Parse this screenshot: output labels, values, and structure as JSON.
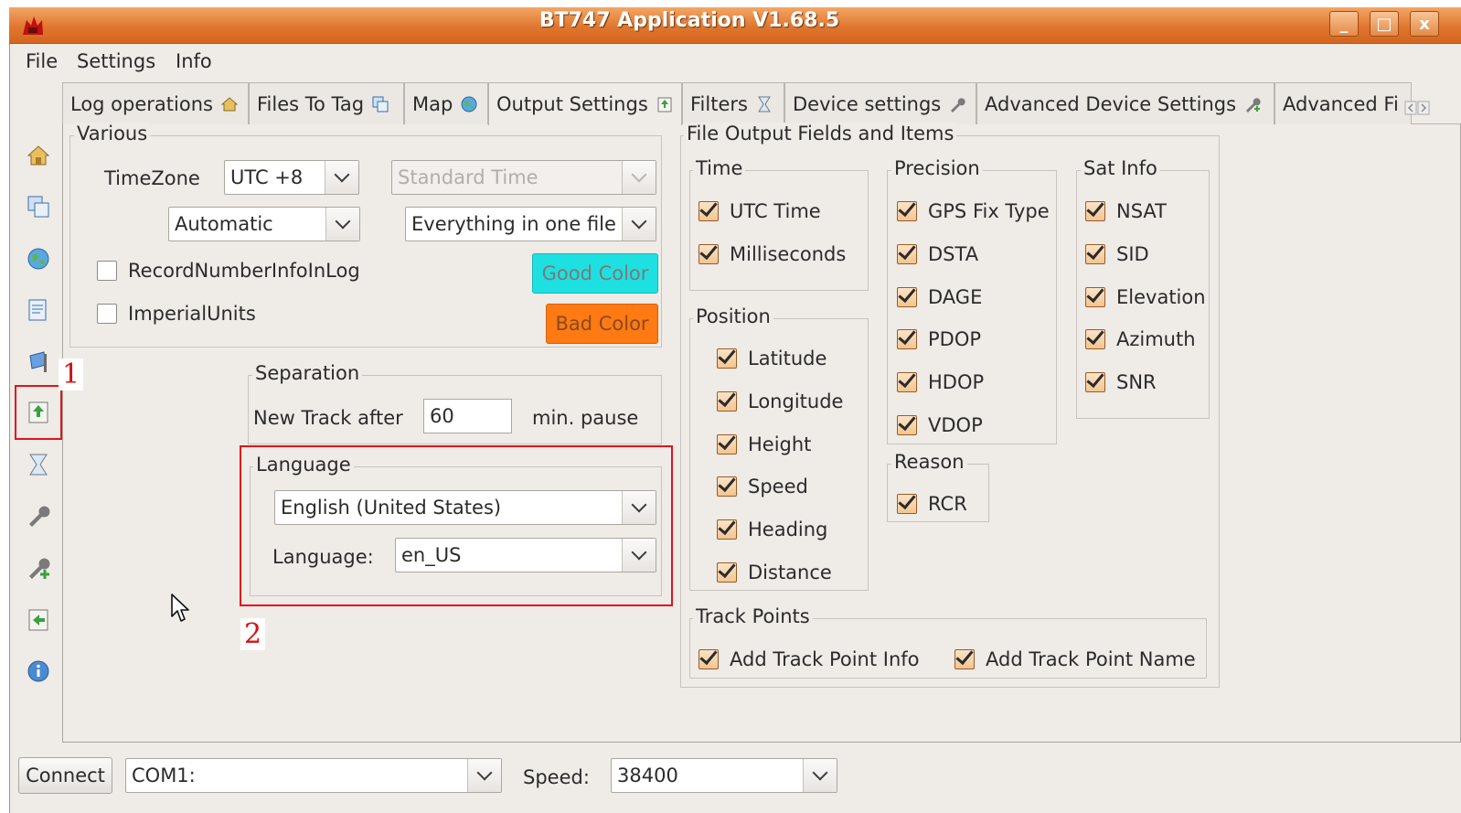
{
  "window": {
    "title": "BT747 Application V1.68.5",
    "controls": {
      "minimize": "_",
      "maximize": "□",
      "close": "x"
    }
  },
  "menu": {
    "items": [
      "File",
      "Settings",
      "Info"
    ]
  },
  "tabs": [
    {
      "label": "Log operations",
      "icon": "home-icon"
    },
    {
      "label": "Files To Tag",
      "icon": "files-icon"
    },
    {
      "label": "Map",
      "icon": "globe-icon"
    },
    {
      "label": "Output Settings",
      "icon": "export-icon",
      "active": true
    },
    {
      "label": "Filters",
      "icon": "hourglass-icon"
    },
    {
      "label": "Device settings",
      "icon": "wrench-icon"
    },
    {
      "label": "Advanced Device Settings",
      "icon": "wrench-plus-icon"
    },
    {
      "label": "Advanced Fi",
      "icon": "scroll-arrows-icon"
    }
  ],
  "various": {
    "legend": "Various",
    "timezone_label": "TimeZone",
    "timezone_value": "UTC +8",
    "standard_time_value": "Standard Time",
    "mode_value": "Automatic",
    "file_split_value": "Everything in one file",
    "record_number_label": "RecordNumberInfoInLog",
    "imperial_units_label": "ImperialUnits",
    "good_color_label": "Good Color",
    "bad_color_label": "Bad Color"
  },
  "separation": {
    "legend": "Separation",
    "new_track_label": "New Track after",
    "new_track_value": "60",
    "unit_label": "min. pause"
  },
  "language": {
    "legend": "Language",
    "language_select_value": "English (United States)",
    "locale_label": "Language:",
    "locale_value": "en_US"
  },
  "file_output": {
    "legend": "File Output Fields and Items",
    "time": {
      "legend": "Time",
      "items": [
        "UTC Time",
        "Milliseconds"
      ]
    },
    "position": {
      "legend": "Position",
      "items": [
        "Latitude",
        "Longitude",
        "Height",
        "Speed",
        "Heading",
        "Distance"
      ]
    },
    "precision": {
      "legend": "Precision",
      "items": [
        "GPS Fix Type",
        "DSTA",
        "DAGE",
        "PDOP",
        "HDOP",
        "VDOP"
      ]
    },
    "sat_info": {
      "legend": "Sat Info",
      "items": [
        "NSAT",
        "SID",
        "Elevation",
        "Azimuth",
        "SNR"
      ]
    },
    "reason": {
      "legend": "Reason",
      "items": [
        "RCR"
      ]
    },
    "track_points": {
      "legend": "Track Points",
      "items": [
        "Add Track Point Info",
        "Add Track Point Name"
      ]
    }
  },
  "bottom": {
    "connect_label": "Connect",
    "port_value": "COM1:",
    "speed_label": "Speed:",
    "speed_value": "38400"
  },
  "annotations": {
    "marker1": "1",
    "marker2": "2"
  },
  "colors": {
    "titlebar": "#e0762f",
    "good_color": "#1fe0e0",
    "bad_color": "#ff7a12",
    "annotation_red": "#e0141a"
  }
}
